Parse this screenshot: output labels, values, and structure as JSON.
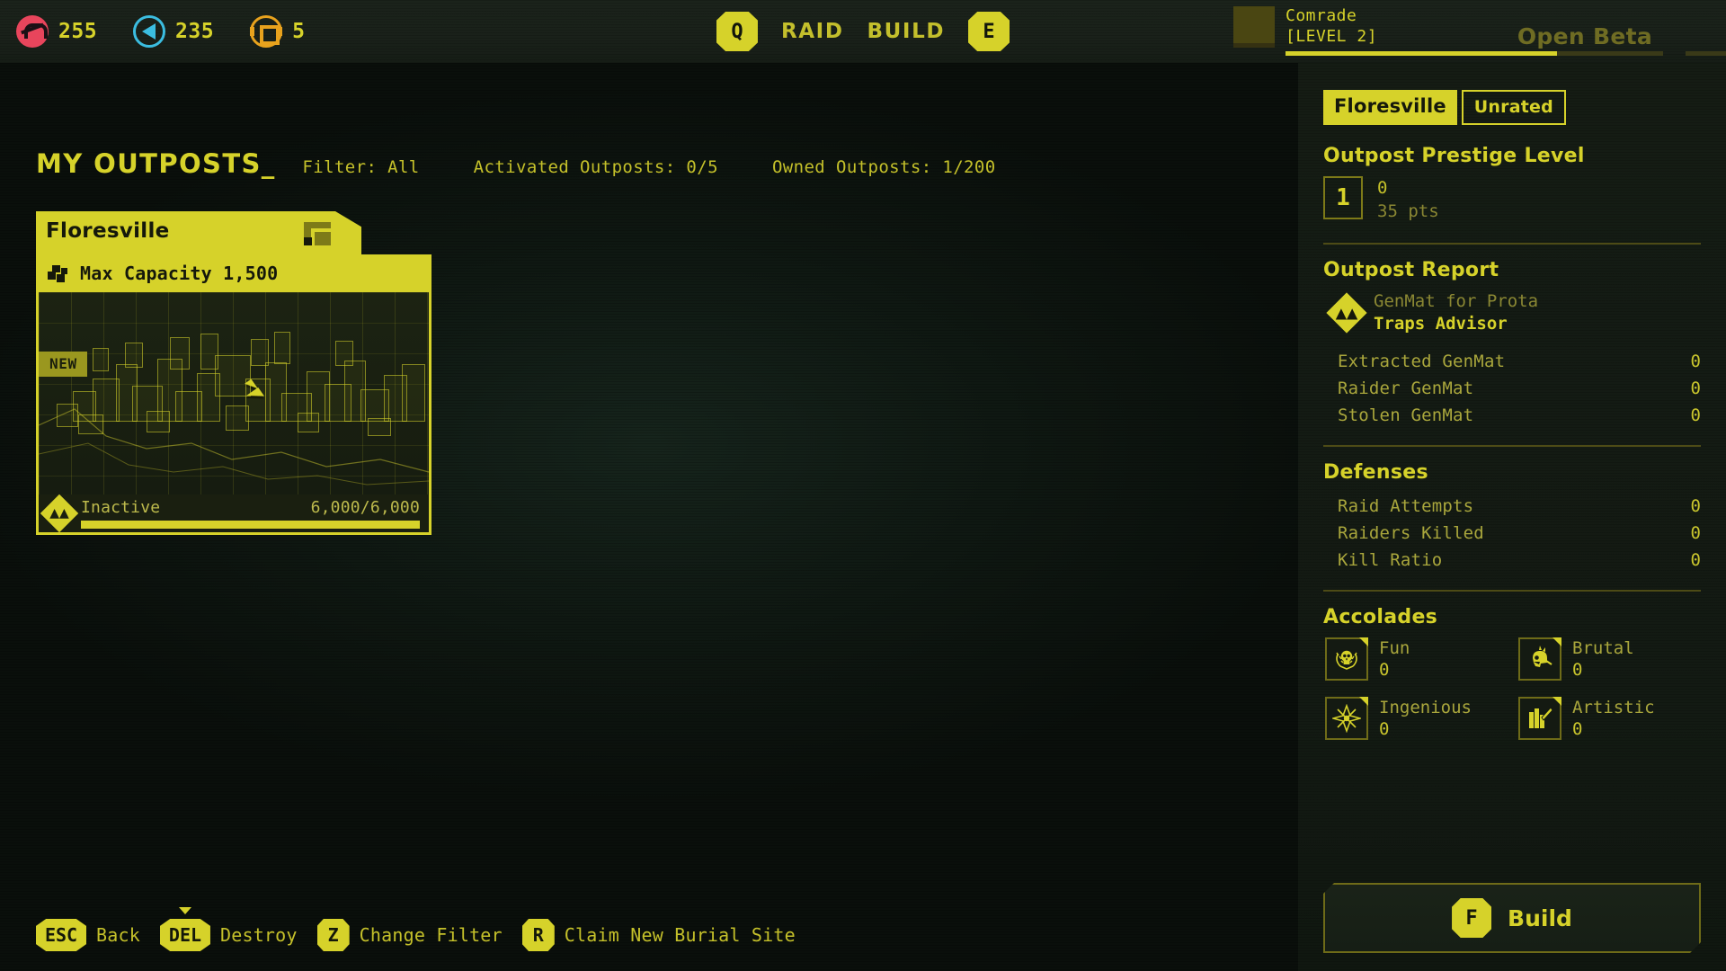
{
  "topbar": {
    "currencies": [
      {
        "icon": "scrap-currency-icon",
        "value": "255",
        "color": "#e8455c"
      },
      {
        "icon": "synthite-currency-icon",
        "value": "235",
        "color": "#3bbde0"
      },
      {
        "icon": "prestige-currency-icon",
        "value": "5",
        "color": "#e8a21d"
      }
    ],
    "nav": [
      {
        "type": "key",
        "label": "Q",
        "name": "raid-hotkey"
      },
      {
        "type": "label",
        "label": "RAID",
        "name": "nav-raid"
      },
      {
        "type": "label",
        "label": "BUILD",
        "name": "nav-build"
      },
      {
        "type": "key",
        "label": "E",
        "name": "build-hotkey"
      }
    ],
    "profile": {
      "name": "Comrade",
      "level": "[LEVEL 2]",
      "beta": "Open Beta",
      "xp_percent": 72
    }
  },
  "main": {
    "page_title": "MY OUTPOSTS_",
    "filters": [
      {
        "label": "Filter: All",
        "name": "filter-all"
      },
      {
        "label": "Activated Outposts: 0/5",
        "name": "activated-outposts"
      },
      {
        "label": "Owned Outposts: 1/200",
        "name": "owned-outposts"
      }
    ],
    "card": {
      "name": "Floresville",
      "capacity": "Max Capacity 1,500",
      "badge": "NEW",
      "status": "Inactive",
      "progress_text": "6,000/6,000",
      "progress_percent": 100
    },
    "hotkeys": [
      {
        "key": "ESC",
        "label": "Back",
        "wide": true,
        "selected": false,
        "name": "hotkey-back"
      },
      {
        "key": "DEL",
        "label": "Destroy",
        "wide": true,
        "selected": true,
        "name": "hotkey-destroy"
      },
      {
        "key": "Z",
        "label": "Change Filter",
        "wide": false,
        "selected": false,
        "name": "hotkey-change-filter"
      },
      {
        "key": "R",
        "label": "Claim New Burial Site",
        "wide": false,
        "selected": false,
        "name": "hotkey-claim-burial-site"
      }
    ]
  },
  "side": {
    "tags": [
      {
        "label": "Floresville",
        "style": "solid",
        "name": "outpost-name-tag"
      },
      {
        "label": "Unrated",
        "style": "outline",
        "name": "outpost-rating-tag"
      }
    ],
    "prestige": {
      "title": "Outpost Prestige Level",
      "level": "1",
      "value": "0",
      "points": "35 pts"
    },
    "report": {
      "title": "Outpost Report",
      "advisor_sub": "GenMat for Prota",
      "advisor_name": "Traps Advisor",
      "stats": [
        {
          "label": "Extracted GenMat",
          "value": "0"
        },
        {
          "label": "Raider GenMat",
          "value": "0"
        },
        {
          "label": "Stolen GenMat",
          "value": "0"
        }
      ]
    },
    "defenses": {
      "title": "Defenses",
      "stats": [
        {
          "label": "Raid Attempts",
          "value": "0"
        },
        {
          "label": "Raiders Killed",
          "value": "0"
        },
        {
          "label": "Kill Ratio",
          "value": "0"
        }
      ]
    },
    "accolades": {
      "title": "Accolades",
      "items": [
        {
          "icon": "skull-laurel-icon",
          "name": "Fun",
          "value": "0"
        },
        {
          "icon": "mohawk-skull-icon",
          "name": "Brutal",
          "value": "0"
        },
        {
          "icon": "atom-star-icon",
          "name": "Ingenious",
          "value": "0"
        },
        {
          "icon": "paint-palette-icon",
          "name": "Artistic",
          "value": "0"
        }
      ]
    },
    "build_button": {
      "key": "F",
      "label": "Build"
    }
  },
  "colors": {
    "accent": "#d6d22a",
    "accent_dim": "#8a8733",
    "background": "#101710"
  }
}
